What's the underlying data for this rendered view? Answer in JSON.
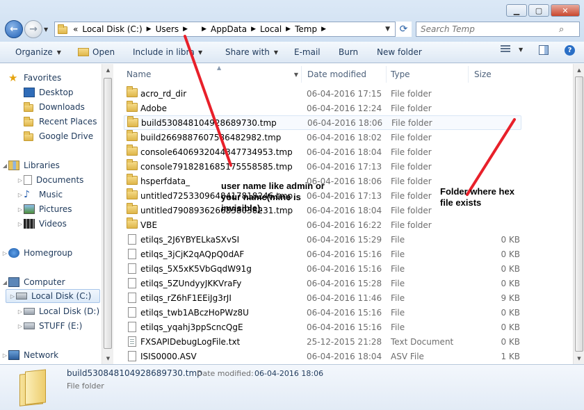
{
  "window": {
    "minimize": "▁",
    "maximize": "▢",
    "close": "✕"
  },
  "address_bar": {
    "overflow": "«",
    "crumbs": [
      "Local Disk (C:)",
      "Users",
      "",
      "AppData",
      "Local",
      "Temp"
    ],
    "search_placeholder": "Search Temp"
  },
  "toolbar": {
    "organize": "Organize",
    "open": "Open",
    "include_in_library": "Include in library",
    "share_with": "Share with",
    "email": "E-mail",
    "burn": "Burn",
    "new_folder": "New folder"
  },
  "nav": {
    "favorites": "Favorites",
    "desktop": "Desktop",
    "downloads": "Downloads",
    "recent_places": "Recent Places",
    "google_drive": "Google Drive",
    "libraries": "Libraries",
    "documents": "Documents",
    "music": "Music",
    "pictures": "Pictures",
    "videos": "Videos",
    "homegroup": "Homegroup",
    "computer": "Computer",
    "local_c": "Local Disk (C:)",
    "local_d": "Local Disk (D:)",
    "stuff_e": "STUFF (E:)",
    "network": "Network"
  },
  "columns": {
    "name": "Name",
    "date_modified": "Date modified",
    "type": "Type",
    "size": "Size"
  },
  "files": [
    {
      "name": "acro_rd_dir",
      "date": "06-04-2016 17:15",
      "type": "File folder",
      "size": "",
      "icon": "folder"
    },
    {
      "name": "Adobe",
      "date": "06-04-2016 12:24",
      "type": "File folder",
      "size": "",
      "icon": "folder"
    },
    {
      "name": "build530848104928689730.tmp",
      "date": "06-04-2016 18:06",
      "type": "File folder",
      "size": "",
      "icon": "folder"
    },
    {
      "name": "build2669887607586482982.tmp",
      "date": "06-04-2016 18:02",
      "type": "File folder",
      "size": "",
      "icon": "folder"
    },
    {
      "name": "console6406932044347734953.tmp",
      "date": "06-04-2016 18:04",
      "type": "File folder",
      "size": "",
      "icon": "folder"
    },
    {
      "name": "console7918281685175558585.tmp",
      "date": "06-04-2016 17:13",
      "type": "File folder",
      "size": "",
      "icon": "folder"
    },
    {
      "name": "hsperfdata_",
      "date": "06-04-2016 18:06",
      "type": "File folder",
      "size": "",
      "icon": "folder"
    },
    {
      "name": "untitled7253309648417818246.tmp",
      "date": "06-04-2016 17:13",
      "type": "File folder",
      "size": "",
      "icon": "folder"
    },
    {
      "name": "untitled7908936266838038231.tmp",
      "date": "06-04-2016 18:04",
      "type": "File folder",
      "size": "",
      "icon": "folder"
    },
    {
      "name": "VBE",
      "date": "06-04-2016 16:22",
      "type": "File folder",
      "size": "",
      "icon": "folder"
    },
    {
      "name": "etilqs_2J6YBYELkaSXvSI",
      "date": "06-04-2016 15:29",
      "type": "File",
      "size": "0 KB",
      "icon": "file"
    },
    {
      "name": "etilqs_3jCjK2qAQpQ0dAF",
      "date": "06-04-2016 15:16",
      "type": "File",
      "size": "0 KB",
      "icon": "file"
    },
    {
      "name": "etilqs_5X5xK5VbGqdW91g",
      "date": "06-04-2016 15:16",
      "type": "File",
      "size": "0 KB",
      "icon": "file"
    },
    {
      "name": "etilqs_5ZUndyyJKKVraFy",
      "date": "06-04-2016 15:28",
      "type": "File",
      "size": "0 KB",
      "icon": "file"
    },
    {
      "name": "etilqs_rZ6hF1EEiJg3rJI",
      "date": "06-04-2016 11:46",
      "type": "File",
      "size": "9 KB",
      "icon": "file"
    },
    {
      "name": "etilqs_twb1ABczHoPWz8U",
      "date": "06-04-2016 15:16",
      "type": "File",
      "size": "0 KB",
      "icon": "file"
    },
    {
      "name": "etilqs_yqahj3ppScncQgE",
      "date": "06-04-2016 15:16",
      "type": "File",
      "size": "0 KB",
      "icon": "file"
    },
    {
      "name": "FXSAPIDebugLogFile.txt",
      "date": "25-12-2015 21:28",
      "type": "Text Document",
      "size": "0 KB",
      "icon": "text"
    },
    {
      "name": "ISIS0000.ASV",
      "date": "06-04-2016 18:04",
      "type": "ASV File",
      "size": "1 KB",
      "icon": "file"
    }
  ],
  "details": {
    "name": "build530848104928689730.tmp",
    "date_modified_label": "Date modified:",
    "date_modified_value": "06-04-2016 18:06",
    "type": "File folder"
  },
  "annotations": {
    "user_note_line1": "user name like admin or",
    "user_note_line2": "your name(mine is",
    "user_note_line3": "invisible).",
    "folder_note_line1": "Folder where hex",
    "folder_note_line2": "file exists",
    "arrow_color": "#e8202a"
  }
}
